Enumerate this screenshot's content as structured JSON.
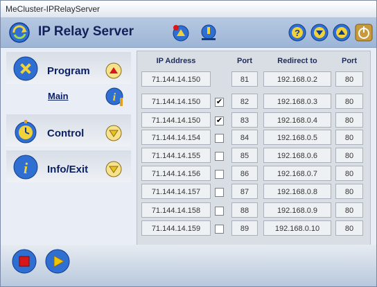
{
  "window": {
    "title": "MeCluster-IPRelayServer"
  },
  "header": {
    "title": "IP Relay Server"
  },
  "icons": {
    "app": "globe-arrow-icon",
    "connect": "network-connect-icon",
    "download": "network-download-icon",
    "help": "help-icon",
    "down": "arrow-down-icon",
    "up": "arrow-up-icon",
    "power": "power-icon"
  },
  "sidebar": {
    "sections": [
      {
        "label": "Program",
        "icon": "tools-icon",
        "state": "expanded"
      },
      {
        "label": "Control",
        "icon": "stopwatch-icon",
        "state": "collapsed"
      },
      {
        "label": "Info/Exit",
        "icon": "info-icon",
        "state": "collapsed"
      }
    ],
    "sub_item": "Main"
  },
  "table": {
    "headers": [
      "IP Address",
      "Port",
      "Redirect to",
      "Port"
    ],
    "rows": [
      {
        "ip": "71.144.14.150",
        "checked": null,
        "port": "81",
        "redirect": "192.168.0.2",
        "rport": "80"
      },
      {
        "ip": "71.144.14.150",
        "checked": true,
        "port": "82",
        "redirect": "192.168.0.3",
        "rport": "80"
      },
      {
        "ip": "71.144.14.150",
        "checked": true,
        "port": "83",
        "redirect": "192.168.0.4",
        "rport": "80"
      },
      {
        "ip": "71.144.14.154",
        "checked": false,
        "port": "84",
        "redirect": "192.168.0.5",
        "rport": "80"
      },
      {
        "ip": "71.144.14.155",
        "checked": false,
        "port": "85",
        "redirect": "192.168.0.6",
        "rport": "80"
      },
      {
        "ip": "71.144.14.156",
        "checked": false,
        "port": "86",
        "redirect": "192.168.0.7",
        "rport": "80"
      },
      {
        "ip": "71.144.14.157",
        "checked": false,
        "port": "87",
        "redirect": "192.168.0.8",
        "rport": "80"
      },
      {
        "ip": "71.144.14.158",
        "checked": false,
        "port": "88",
        "redirect": "192.168.0.9",
        "rport": "80"
      },
      {
        "ip": "71.144.14.159",
        "checked": false,
        "port": "89",
        "redirect": "192.168.0.10",
        "rport": "80"
      }
    ]
  },
  "footer": {
    "stop_icon": "stop-icon",
    "play_icon": "play-icon"
  },
  "colors": {
    "accent": "#12215a",
    "header_bg": "#a9bedb",
    "stop": "#d81818",
    "play": "#f0c400",
    "button_blue": "#2f6fd1"
  }
}
